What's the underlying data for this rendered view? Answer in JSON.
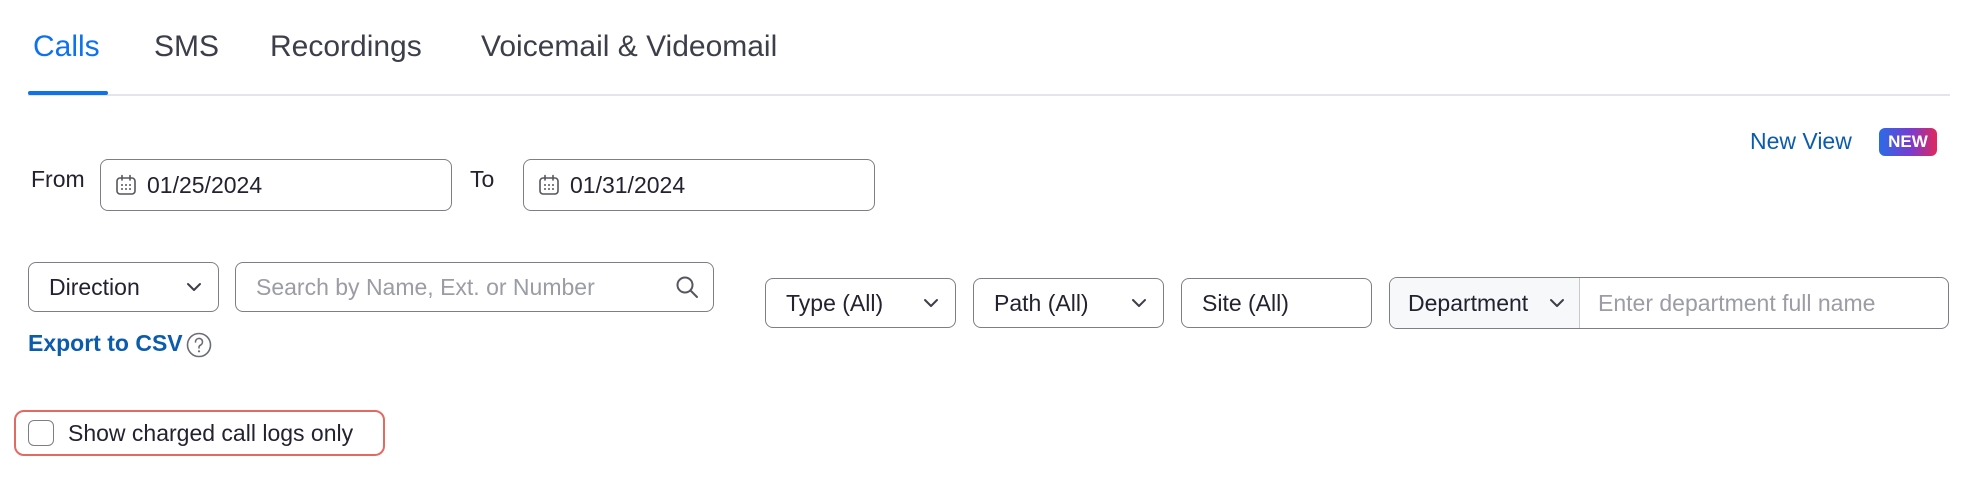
{
  "tabs": [
    {
      "label": "Calls",
      "active": true
    },
    {
      "label": "SMS",
      "active": false
    },
    {
      "label": "Recordings",
      "active": false
    },
    {
      "label": "Voicemail & Videomail",
      "active": false
    }
  ],
  "new_view": {
    "label": "New View",
    "badge": "NEW"
  },
  "date_range": {
    "from_label": "From",
    "from_value": "01/25/2024",
    "to_label": "To",
    "to_value": "01/31/2024"
  },
  "filters": {
    "direction": "Direction",
    "search_placeholder": "Search by Name, Ext. or Number",
    "type": "Type (All)",
    "path": "Path (All)",
    "site": "Site (All)",
    "department": "Department",
    "department_placeholder": "Enter department full name"
  },
  "export": {
    "label": "Export to CSV"
  },
  "charged_only": {
    "label": "Show charged call logs only",
    "checked": false
  },
  "colors": {
    "accent": "#0e72ed",
    "link": "#0b5cad",
    "highlight": "#e26a62"
  },
  "icons": {
    "calendar": "calendar-icon",
    "search": "search-icon",
    "help": "help-circle-icon",
    "chevron": "chevron-down-icon"
  }
}
